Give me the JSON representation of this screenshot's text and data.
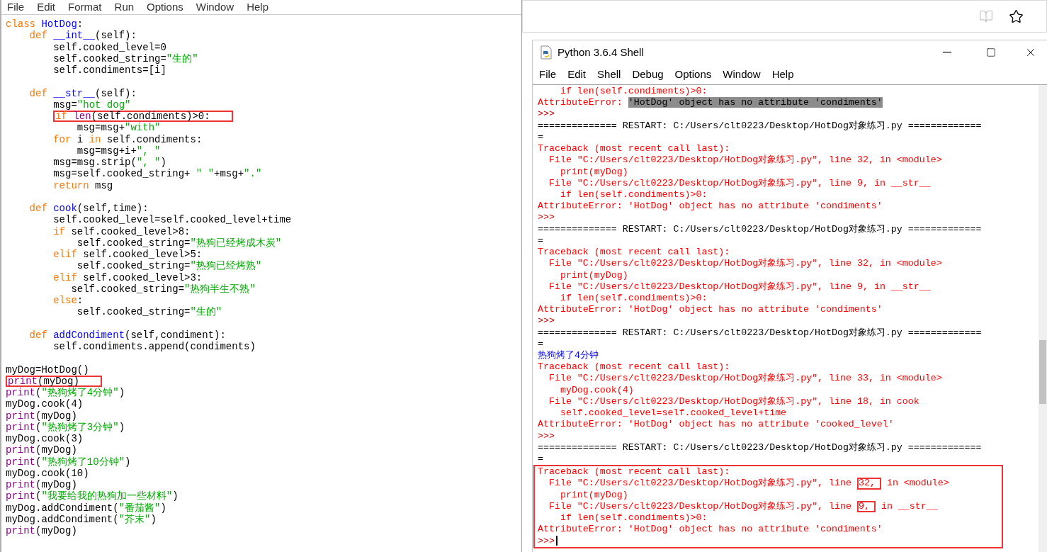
{
  "editor": {
    "menu": [
      "File",
      "Edit",
      "Format",
      "Run",
      "Options",
      "Window",
      "Help"
    ],
    "lines": [
      {
        "kind": "code",
        "boxed": false,
        "tokens": [
          {
            "text": "class",
            "kind": "keyword"
          },
          {
            "text": " HotDog",
            "kind": "defname"
          },
          {
            "text": ":",
            "kind": "plain"
          }
        ]
      },
      {
        "kind": "code",
        "boxed": false,
        "tokens": [
          {
            "text": "    def",
            "kind": "keyword"
          },
          {
            "text": " __int__",
            "kind": "defname"
          },
          {
            "text": "(self):",
            "kind": "plain"
          }
        ]
      },
      {
        "kind": "code",
        "boxed": false,
        "tokens": [
          {
            "text": "        self.cooked_level=0",
            "kind": "plain"
          }
        ]
      },
      {
        "kind": "code",
        "boxed": false,
        "tokens": [
          {
            "text": "        self.cooked_string=",
            "kind": "plain"
          },
          {
            "text": "\"生的\"",
            "kind": "string"
          }
        ]
      },
      {
        "kind": "code",
        "boxed": false,
        "tokens": [
          {
            "text": "        self.condiments=[i]",
            "kind": "plain"
          }
        ]
      },
      {
        "kind": "blank"
      },
      {
        "kind": "code",
        "boxed": false,
        "tokens": [
          {
            "text": "    def",
            "kind": "keyword"
          },
          {
            "text": " __str__",
            "kind": "defname"
          },
          {
            "text": "(self):",
            "kind": "plain"
          }
        ]
      },
      {
        "kind": "code",
        "boxed": false,
        "tokens": [
          {
            "text": "        msg=",
            "kind": "plain"
          },
          {
            "text": "\"hot dog\"",
            "kind": "string"
          }
        ]
      },
      {
        "kind": "code",
        "boxed": true,
        "tokens": [
          {
            "text": "        if",
            "kind": "keyword"
          },
          {
            "text": " len",
            "kind": "builtin"
          },
          {
            "text": "(self.condiments)>0:",
            "kind": "plain"
          }
        ]
      },
      {
        "kind": "code",
        "boxed": false,
        "tokens": [
          {
            "text": "            msg=msg+",
            "kind": "plain"
          },
          {
            "text": "\"with\"",
            "kind": "string"
          }
        ]
      },
      {
        "kind": "code",
        "boxed": false,
        "tokens": [
          {
            "text": "        for",
            "kind": "keyword"
          },
          {
            "text": " i ",
            "kind": "plain"
          },
          {
            "text": "in",
            "kind": "keyword"
          },
          {
            "text": " self.condiments:",
            "kind": "plain"
          }
        ]
      },
      {
        "kind": "code",
        "boxed": false,
        "tokens": [
          {
            "text": "            msg=msg+i+",
            "kind": "plain"
          },
          {
            "text": "\", \"",
            "kind": "string"
          }
        ]
      },
      {
        "kind": "code",
        "boxed": false,
        "tokens": [
          {
            "text": "        msg=msg.strip(",
            "kind": "plain"
          },
          {
            "text": "\", \"",
            "kind": "string"
          },
          {
            "text": ")",
            "kind": "plain"
          }
        ]
      },
      {
        "kind": "code",
        "boxed": false,
        "tokens": [
          {
            "text": "        msg=self.cooked_string+ ",
            "kind": "plain"
          },
          {
            "text": "\" \"",
            "kind": "string"
          },
          {
            "text": "+msg+",
            "kind": "plain"
          },
          {
            "text": "\".\"",
            "kind": "string"
          }
        ]
      },
      {
        "kind": "code",
        "boxed": false,
        "tokens": [
          {
            "text": "        return",
            "kind": "keyword"
          },
          {
            "text": " msg",
            "kind": "plain"
          }
        ]
      },
      {
        "kind": "blank"
      },
      {
        "kind": "code",
        "boxed": false,
        "tokens": [
          {
            "text": "    def",
            "kind": "keyword"
          },
          {
            "text": " cook",
            "kind": "defname"
          },
          {
            "text": "(self,time):",
            "kind": "plain"
          }
        ]
      },
      {
        "kind": "code",
        "boxed": false,
        "tokens": [
          {
            "text": "        self.cooked_level=self.cooked_level+time",
            "kind": "plain"
          }
        ]
      },
      {
        "kind": "code",
        "boxed": false,
        "tokens": [
          {
            "text": "        if",
            "kind": "keyword"
          },
          {
            "text": " self.cooked_level>8:",
            "kind": "plain"
          }
        ]
      },
      {
        "kind": "code",
        "boxed": false,
        "tokens": [
          {
            "text": "            self.cooked_string=",
            "kind": "plain"
          },
          {
            "text": "\"热狗已经烤成木炭\"",
            "kind": "string"
          }
        ]
      },
      {
        "kind": "code",
        "boxed": false,
        "tokens": [
          {
            "text": "        elif",
            "kind": "keyword"
          },
          {
            "text": " self.cooked_level>5:",
            "kind": "plain"
          }
        ]
      },
      {
        "kind": "code",
        "boxed": false,
        "tokens": [
          {
            "text": "            self.cooked_string=",
            "kind": "plain"
          },
          {
            "text": "\"热狗已经烤熟\"",
            "kind": "string"
          }
        ]
      },
      {
        "kind": "code",
        "boxed": false,
        "tokens": [
          {
            "text": "        elif",
            "kind": "keyword"
          },
          {
            "text": " self.cooked_level>3:",
            "kind": "plain"
          }
        ]
      },
      {
        "kind": "code",
        "boxed": false,
        "tokens": [
          {
            "text": "           self.cooked_string=",
            "kind": "plain"
          },
          {
            "text": "\"热狗半生不熟\"",
            "kind": "string"
          }
        ]
      },
      {
        "kind": "code",
        "boxed": false,
        "tokens": [
          {
            "text": "        else",
            "kind": "keyword"
          },
          {
            "text": ":",
            "kind": "plain"
          }
        ]
      },
      {
        "kind": "code",
        "boxed": false,
        "tokens": [
          {
            "text": "            self.cooked_string=",
            "kind": "plain"
          },
          {
            "text": "\"生的\"",
            "kind": "string"
          }
        ]
      },
      {
        "kind": "blank"
      },
      {
        "kind": "code",
        "boxed": false,
        "tokens": [
          {
            "text": "    def",
            "kind": "keyword"
          },
          {
            "text": " addCondiment",
            "kind": "defname"
          },
          {
            "text": "(self,condiment):",
            "kind": "plain"
          }
        ]
      },
      {
        "kind": "code",
        "boxed": false,
        "tokens": [
          {
            "text": "        self.condiments.append(condiments)",
            "kind": "plain"
          }
        ]
      },
      {
        "kind": "blank"
      },
      {
        "kind": "code",
        "boxed": false,
        "tokens": [
          {
            "text": "myDog=HotDog()",
            "kind": "plain"
          }
        ]
      },
      {
        "kind": "code",
        "boxed": true,
        "tokens": [
          {
            "text": "print",
            "kind": "builtin"
          },
          {
            "text": "(myDog)",
            "kind": "plain"
          }
        ]
      },
      {
        "kind": "code",
        "boxed": false,
        "tokens": [
          {
            "text": "print",
            "kind": "builtin"
          },
          {
            "text": "(",
            "kind": "plain"
          },
          {
            "text": "\"热狗烤了4分钟\"",
            "kind": "string"
          },
          {
            "text": ")",
            "kind": "plain"
          }
        ]
      },
      {
        "kind": "code",
        "boxed": false,
        "tokens": [
          {
            "text": "myDog.cook(4)",
            "kind": "plain"
          }
        ]
      },
      {
        "kind": "code",
        "boxed": false,
        "tokens": [
          {
            "text": "print",
            "kind": "builtin"
          },
          {
            "text": "(myDog)",
            "kind": "plain"
          }
        ]
      },
      {
        "kind": "code",
        "boxed": false,
        "tokens": [
          {
            "text": "print",
            "kind": "builtin"
          },
          {
            "text": "(",
            "kind": "plain"
          },
          {
            "text": "\"热狗烤了3分钟\"",
            "kind": "string"
          },
          {
            "text": ")",
            "kind": "plain"
          }
        ]
      },
      {
        "kind": "code",
        "boxed": false,
        "tokens": [
          {
            "text": "myDog.cook(3)",
            "kind": "plain"
          }
        ]
      },
      {
        "kind": "code",
        "boxed": false,
        "tokens": [
          {
            "text": "print",
            "kind": "builtin"
          },
          {
            "text": "(myDog)",
            "kind": "plain"
          }
        ]
      },
      {
        "kind": "code",
        "boxed": false,
        "tokens": [
          {
            "text": "print",
            "kind": "builtin"
          },
          {
            "text": "(",
            "kind": "plain"
          },
          {
            "text": "\"热狗烤了10分钟\"",
            "kind": "string"
          },
          {
            "text": ")",
            "kind": "plain"
          }
        ]
      },
      {
        "kind": "code",
        "boxed": false,
        "tokens": [
          {
            "text": "myDog.cook(10)",
            "kind": "plain"
          }
        ]
      },
      {
        "kind": "code",
        "boxed": false,
        "tokens": [
          {
            "text": "print",
            "kind": "builtin"
          },
          {
            "text": "(myDog)",
            "kind": "plain"
          }
        ]
      },
      {
        "kind": "code",
        "boxed": false,
        "tokens": [
          {
            "text": "print",
            "kind": "builtin"
          },
          {
            "text": "(",
            "kind": "plain"
          },
          {
            "text": "\"我要给我的热狗加一些材料\"",
            "kind": "string"
          },
          {
            "text": ")",
            "kind": "plain"
          }
        ]
      },
      {
        "kind": "code",
        "boxed": false,
        "tokens": [
          {
            "text": "myDog.addCondiment(",
            "kind": "plain"
          },
          {
            "text": "\"番茄酱\"",
            "kind": "string"
          },
          {
            "text": ")",
            "kind": "plain"
          }
        ]
      },
      {
        "kind": "code",
        "boxed": false,
        "tokens": [
          {
            "text": "myDog.addCondiment(",
            "kind": "plain"
          },
          {
            "text": "\"芥末\"",
            "kind": "string"
          },
          {
            "text": ")",
            "kind": "plain"
          }
        ]
      },
      {
        "kind": "code",
        "boxed": false,
        "tokens": [
          {
            "text": "print",
            "kind": "builtin"
          },
          {
            "text": "(myDog)",
            "kind": "plain"
          }
        ]
      }
    ]
  },
  "shell": {
    "title": "Python 3.6.4 Shell",
    "menu": [
      "File",
      "Edit",
      "Shell",
      "Debug",
      "Options",
      "Window",
      "Help"
    ],
    "blocks": [
      {
        "boxed": false,
        "lines": [
          [
            {
              "text": "    if len(self.condiments)>0:",
              "kind": "error"
            }
          ],
          [
            {
              "text": "AttributeError: ",
              "kind": "error"
            },
            {
              "text": "'HotDog' object has no attribute 'condiments'",
              "kind": "error",
              "selected": true
            }
          ],
          [
            {
              "text": ">>>",
              "kind": "prompt"
            }
          ],
          [
            {
              "text": "============== RESTART: C:/Users/clt0223/Desktop/HotDog对象练习.py =============",
              "kind": "plain"
            }
          ],
          [
            {
              "text": "=",
              "kind": "plain"
            }
          ],
          [
            {
              "text": "Traceback (most recent call last):",
              "kind": "error"
            }
          ],
          [
            {
              "text": "  File \"C:/Users/clt0223/Desktop/HotDog对象练习.py\", line 32, in <module>",
              "kind": "error"
            }
          ],
          [
            {
              "text": "    print(myDog)",
              "kind": "error"
            }
          ],
          [
            {
              "text": "  File \"C:/Users/clt0223/Desktop/HotDog对象练习.py\", line 9, in __str__",
              "kind": "error"
            }
          ],
          [
            {
              "text": "    if len(self.condiments)>0:",
              "kind": "error"
            }
          ],
          [
            {
              "text": "AttributeError: 'HotDog' object has no attribute 'condiments'",
              "kind": "error"
            }
          ],
          [
            {
              "text": ">>>",
              "kind": "prompt"
            }
          ],
          [
            {
              "text": "============== RESTART: C:/Users/clt0223/Desktop/HotDog对象练习.py =============",
              "kind": "plain"
            }
          ],
          [
            {
              "text": "=",
              "kind": "plain"
            }
          ],
          [
            {
              "text": "Traceback (most recent call last):",
              "kind": "error"
            }
          ],
          [
            {
              "text": "  File \"C:/Users/clt0223/Desktop/HotDog对象练习.py\", line 32, in <module>",
              "kind": "error"
            }
          ],
          [
            {
              "text": "    print(myDog)",
              "kind": "error"
            }
          ],
          [
            {
              "text": "  File \"C:/Users/clt0223/Desktop/HotDog对象练习.py\", line 9, in __str__",
              "kind": "error"
            }
          ],
          [
            {
              "text": "    if len(self.condiments)>0:",
              "kind": "error"
            }
          ],
          [
            {
              "text": "AttributeError: 'HotDog' object has no attribute 'condiments'",
              "kind": "error"
            }
          ],
          [
            {
              "text": ">>>",
              "kind": "prompt"
            }
          ],
          [
            {
              "text": "============== RESTART: C:/Users/clt0223/Desktop/HotDog对象练习.py =============",
              "kind": "plain"
            }
          ],
          [
            {
              "text": "=",
              "kind": "plain"
            }
          ],
          [
            {
              "text": "热狗烤了4分钟",
              "kind": "stdout"
            }
          ],
          [
            {
              "text": "Traceback (most recent call last):",
              "kind": "error"
            }
          ],
          [
            {
              "text": "  File \"C:/Users/clt0223/Desktop/HotDog对象练习.py\", line 33, in <module>",
              "kind": "error"
            }
          ],
          [
            {
              "text": "    myDog.cook(4)",
              "kind": "error"
            }
          ],
          [
            {
              "text": "  File \"C:/Users/clt0223/Desktop/HotDog对象练习.py\", line 18, in cook",
              "kind": "error"
            }
          ],
          [
            {
              "text": "    self.cooked_level=self.cooked_level+time",
              "kind": "error"
            }
          ],
          [
            {
              "text": "AttributeError: 'HotDog' object has no attribute 'cooked_level'",
              "kind": "error"
            }
          ],
          [
            {
              "text": ">>>",
              "kind": "prompt"
            }
          ],
          [
            {
              "text": "============== RESTART: C:/Users/clt0223/Desktop/HotDog对象练习.py =============",
              "kind": "plain"
            }
          ],
          [
            {
              "text": "=",
              "kind": "plain"
            }
          ]
        ]
      },
      {
        "boxed": true,
        "lines": [
          [
            {
              "text": "Traceback (most recent call last):",
              "kind": "error"
            }
          ],
          [
            {
              "text": "  File \"C:/Users/clt0223/Desktop/HotDog对象练习.py\", line ",
              "kind": "error"
            },
            {
              "text": "32,",
              "kind": "error",
              "boxed": true
            },
            {
              "text": " in <module>",
              "kind": "error"
            }
          ],
          [
            {
              "text": "    print(myDog)",
              "kind": "error"
            }
          ],
          [
            {
              "text": "  File \"C:/Users/clt0223/Desktop/HotDog对象练习.py\", line ",
              "kind": "error"
            },
            {
              "text": "9,",
              "kind": "error",
              "boxed": true
            },
            {
              "text": " in __str__",
              "kind": "error"
            }
          ],
          [
            {
              "text": "    if len(self.condiments)>0:",
              "kind": "error"
            }
          ],
          [
            {
              "text": "AttributeError: 'HotDog' object has no attribute 'condiments'",
              "kind": "error"
            }
          ],
          [
            {
              "text": ">>>",
              "kind": "prompt",
              "cursor": true
            }
          ]
        ]
      }
    ]
  }
}
